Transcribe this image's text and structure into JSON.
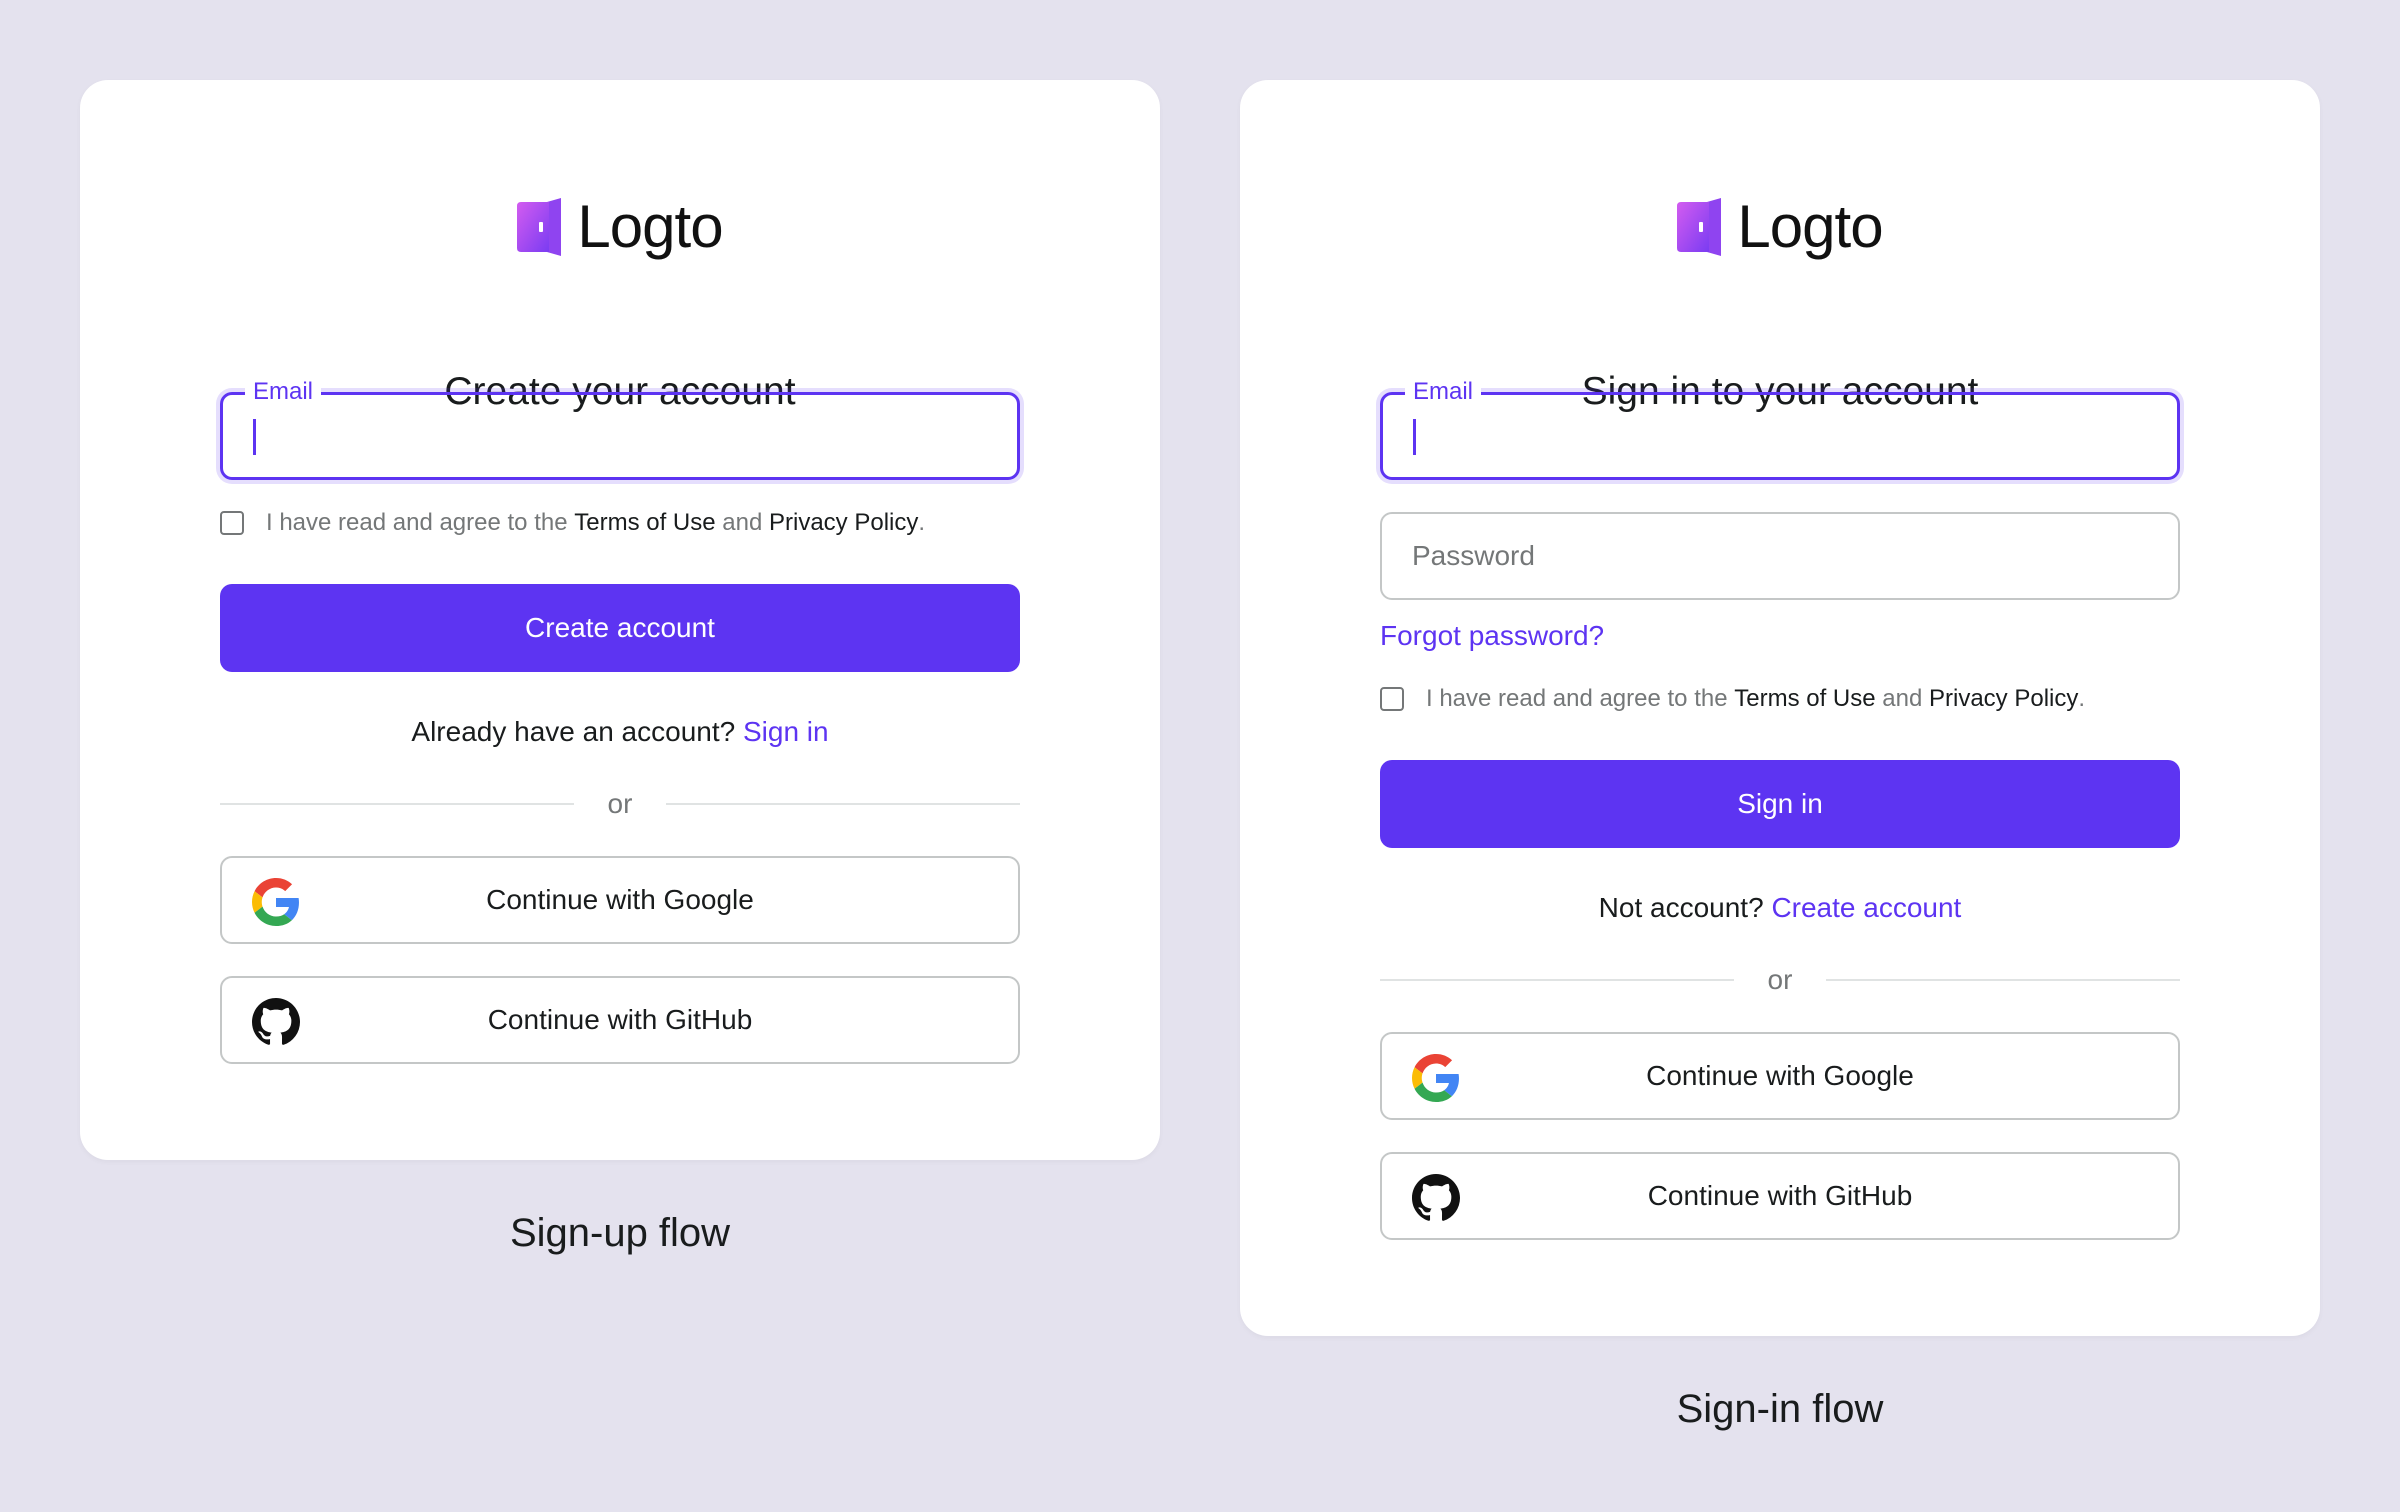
{
  "colors": {
    "background": "#e4e2ee",
    "primary": "#5d34f2",
    "text": "#191c1d",
    "muted": "#747778",
    "border": "#c4c7c7"
  },
  "brand": {
    "name": "Logto",
    "icon": "logto-door-icon"
  },
  "signup": {
    "title": "Create your account",
    "email_label": "Email",
    "terms": {
      "prefix": "I have read and agree to the",
      "terms_link": "Terms of Use",
      "and": "and",
      "privacy_link": "Privacy Policy",
      "suffix": "."
    },
    "submit_label": "Create account",
    "switch_text": "Already have an account?",
    "switch_link": "Sign in",
    "divider": "or",
    "social": [
      {
        "label": "Continue with Google",
        "icon": "google-icon"
      },
      {
        "label": "Continue with GitHub",
        "icon": "github-icon"
      }
    ],
    "caption": "Sign-up flow"
  },
  "signin": {
    "title": "Sign in to your account",
    "email_label": "Email",
    "password_placeholder": "Password",
    "forgot_label": "Forgot password?",
    "terms": {
      "prefix": "I have read and agree to the",
      "terms_link": "Terms of Use",
      "and": "and",
      "privacy_link": "Privacy Policy",
      "suffix": "."
    },
    "submit_label": "Sign in",
    "switch_text": "Not account?",
    "switch_link": "Create account",
    "divider": "or",
    "social": [
      {
        "label": "Continue with Google",
        "icon": "google-icon"
      },
      {
        "label": "Continue with GitHub",
        "icon": "github-icon"
      }
    ],
    "caption": "Sign-in flow"
  }
}
